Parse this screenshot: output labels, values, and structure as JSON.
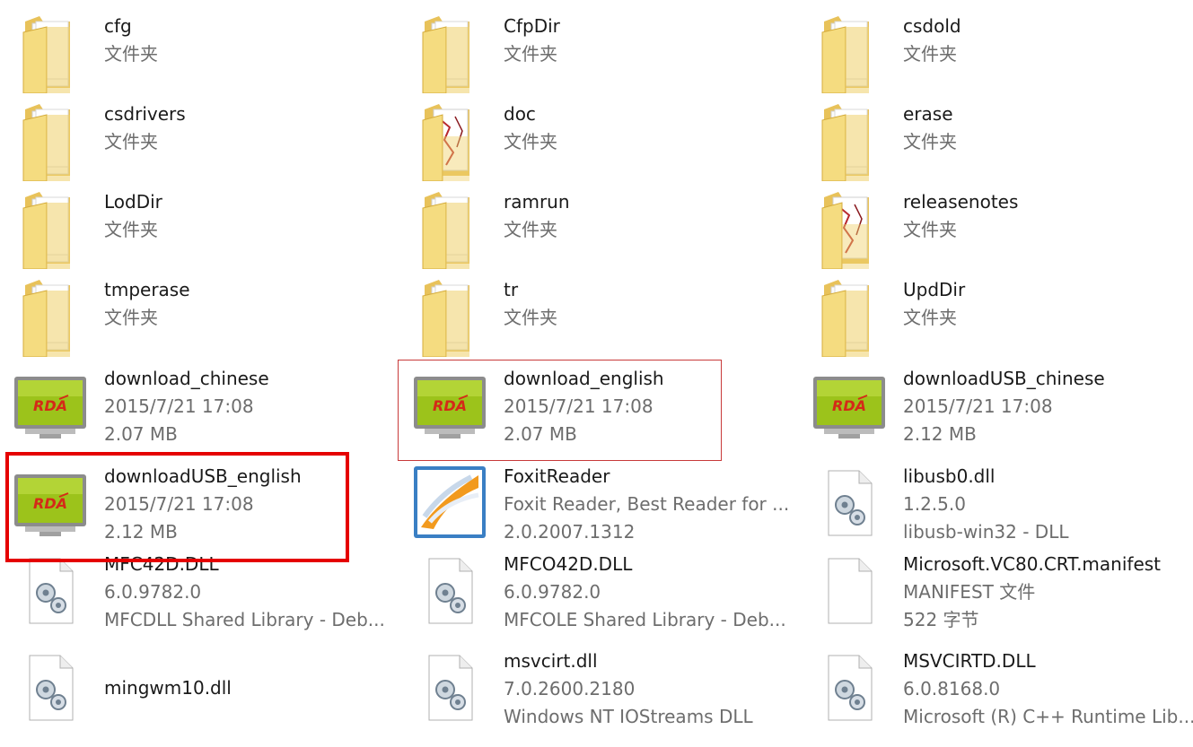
{
  "files": [
    {
      "name": "cfg",
      "lines": [
        "文件夹"
      ],
      "icon": "folder-icon"
    },
    {
      "name": "CfpDir",
      "lines": [
        "文件夹"
      ],
      "icon": "folder-icon"
    },
    {
      "name": "csdold",
      "lines": [
        "文件夹"
      ],
      "icon": "folder-icon"
    },
    {
      "name": "csdrivers",
      "lines": [
        "文件夹"
      ],
      "icon": "folder-icon"
    },
    {
      "name": "doc",
      "lines": [
        "文件夹"
      ],
      "icon": "folder-docs-icon"
    },
    {
      "name": "erase",
      "lines": [
        "文件夹"
      ],
      "icon": "folder-icon"
    },
    {
      "name": "LodDir",
      "lines": [
        "文件夹"
      ],
      "icon": "folder-icon"
    },
    {
      "name": "ramrun",
      "lines": [
        "文件夹"
      ],
      "icon": "folder-icon"
    },
    {
      "name": "releasenotes",
      "lines": [
        "文件夹"
      ],
      "icon": "folder-docs-icon"
    },
    {
      "name": "tmperase",
      "lines": [
        "文件夹"
      ],
      "icon": "folder-icon"
    },
    {
      "name": "tr",
      "lines": [
        "文件夹"
      ],
      "icon": "folder-icon"
    },
    {
      "name": "UpdDir",
      "lines": [
        "文件夹"
      ],
      "icon": "folder-icon"
    },
    {
      "name": "download_chinese",
      "lines": [
        "2015/7/21 17:08",
        "2.07 MB"
      ],
      "icon": "rda-app-icon"
    },
    {
      "name": "download_english",
      "lines": [
        "2015/7/21 17:08",
        "2.07 MB"
      ],
      "icon": "rda-app-icon"
    },
    {
      "name": "downloadUSB_chinese",
      "lines": [
        "2015/7/21 17:08",
        "2.12 MB"
      ],
      "icon": "rda-app-icon"
    },
    {
      "name": "downloadUSB_english",
      "lines": [
        "2015/7/21 17:08",
        "2.12 MB"
      ],
      "icon": "rda-app-icon"
    },
    {
      "name": "FoxitReader",
      "lines": [
        "Foxit Reader, Best Reader for ...",
        "2.0.2007.1312"
      ],
      "icon": "foxit-reader-icon"
    },
    {
      "name": "libusb0.dll",
      "lines": [
        "1.2.5.0",
        "libusb-win32 - DLL"
      ],
      "icon": "dll-gear-icon"
    },
    {
      "name": "MFC42D.DLL",
      "lines": [
        "6.0.9782.0",
        "MFCDLL Shared Library - Deb..."
      ],
      "icon": "dll-gear-icon"
    },
    {
      "name": "MFCO42D.DLL",
      "lines": [
        "6.0.9782.0",
        "MFCOLE Shared Library - Deb..."
      ],
      "icon": "dll-gear-icon"
    },
    {
      "name": "Microsoft.VC80.CRT.manifest",
      "lines": [
        "MANIFEST 文件",
        "522 字节"
      ],
      "icon": "blank-file-icon"
    },
    {
      "name": "mingwm10.dll",
      "lines": [],
      "icon": "dll-gear-icon"
    },
    {
      "name": "msvcirt.dll",
      "lines": [
        "7.0.2600.2180",
        "Windows NT IOStreams DLL"
      ],
      "icon": "dll-gear-icon"
    },
    {
      "name": "MSVCIRTD.DLL",
      "lines": [
        "6.0.8168.0",
        "Microsoft (R) C++ Runtime Lib..."
      ],
      "icon": "dll-gear-icon"
    }
  ],
  "colors": {
    "folder": "#f3d77a",
    "folder_dark": "#d9b24a",
    "highlight_thin": "#c83a3a",
    "highlight_thick": "#e50000",
    "rda_screen": "#9cc31b"
  }
}
